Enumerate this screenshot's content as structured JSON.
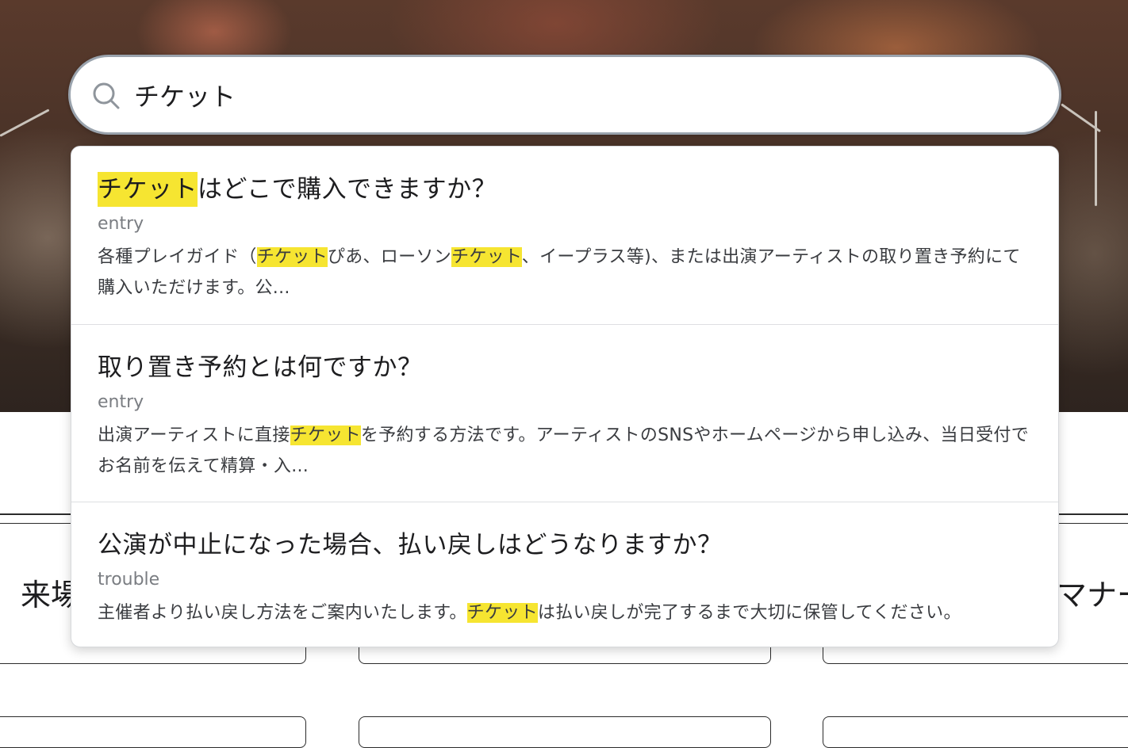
{
  "search": {
    "query": "チケット"
  },
  "cards": [
    {
      "title": "来場"
    },
    {
      "title": "マナー"
    }
  ],
  "results": [
    {
      "title_pre": "",
      "title_hl": "チケット",
      "title_post": "はどこで購入できますか？",
      "category": "entry",
      "snippet": [
        {
          "t": "各種プレイガイド（",
          "h": false
        },
        {
          "t": "チケット",
          "h": true
        },
        {
          "t": "ぴあ、ローソン",
          "h": false
        },
        {
          "t": "チケット",
          "h": true
        },
        {
          "t": "、イープラス等)、または出演アーティストの取り置き予約にて購入いただけます。公...",
          "h": false
        }
      ]
    },
    {
      "title_pre": "取り置き予約とは何ですか？",
      "title_hl": "",
      "title_post": "",
      "category": "entry",
      "snippet": [
        {
          "t": "出演アーティストに直接",
          "h": false
        },
        {
          "t": "チケット",
          "h": true
        },
        {
          "t": "を予約する方法です。アーティストのSNSやホームページから申し込み、当日受付でお名前を伝えて精算・入...",
          "h": false
        }
      ]
    },
    {
      "title_pre": "公演が中止になった場合、払い戻しはどうなりますか？",
      "title_hl": "",
      "title_post": "",
      "category": "trouble",
      "snippet": [
        {
          "t": "主催者より払い戻し方法をご案内いたします。",
          "h": false
        },
        {
          "t": "チケット",
          "h": true
        },
        {
          "t": "は払い戻しが完了するまで大切に保管してください。",
          "h": false
        }
      ]
    }
  ]
}
